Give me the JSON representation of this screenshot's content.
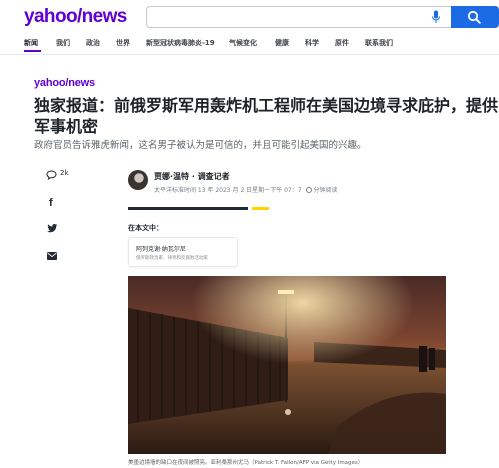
{
  "header": {
    "logo_yahoo": "yahoo",
    "logo_slash": "/",
    "logo_news": "news",
    "search_placeholder": ""
  },
  "nav": {
    "items": [
      {
        "label": "新闻",
        "active": true
      },
      {
        "label": "我们",
        "active": false
      },
      {
        "label": "政治",
        "active": false
      },
      {
        "label": "世界",
        "active": false
      },
      {
        "label": "新型冠状病毒肺炎-19",
        "active": false
      },
      {
        "label": "气候变化",
        "active": false
      },
      {
        "label": "健康",
        "active": false
      },
      {
        "label": "科学",
        "active": false
      },
      {
        "label": "原件",
        "active": false
      },
      {
        "label": "联系我们",
        "active": false
      }
    ]
  },
  "article": {
    "brand": "yahoo/news",
    "headline": "独家报道：前俄罗斯军用轰炸机工程师在美国边境寻求庇护，提供军事机密",
    "subhead": "政府官员告诉雅虎新闻，这名男子被认为是可信的，并且可能引起美国的兴趣。",
    "author": "贾娜·温特 · 调查记者",
    "dateline": "太平洋标准时间 13 年 2023 月 2 日星期一下午 07：7",
    "read_time": "分钟阅读",
    "in_article_label": "在本文中：",
    "card_name": "阿列克谢·纳瓦尔尼",
    "card_desc": "俄罗斯政治家、律师和反腐败活动家",
    "caption": "美墨边境墙的缺口在夜间被照亮。亚利桑那州尤马（Patrick T. Fallon/AFP via Getty Images）"
  },
  "share": {
    "comment_count": "2k",
    "icons": [
      "comment-icon",
      "facebook-icon",
      "twitter-icon",
      "mail-icon"
    ]
  },
  "colors": {
    "brand_purple": "#6001d2",
    "search_blue": "#1d6ae5",
    "accent_yellow": "#ffd400"
  }
}
